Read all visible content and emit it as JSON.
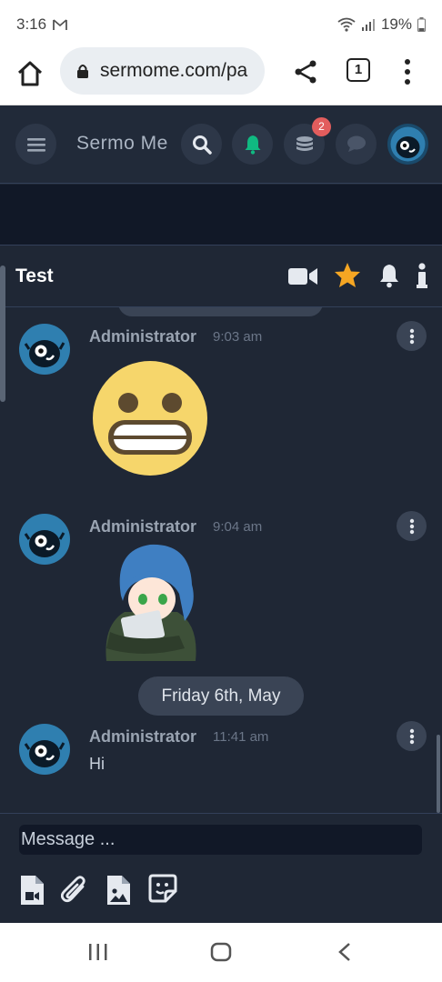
{
  "status": {
    "time": "3:16",
    "battery": "19%"
  },
  "browser": {
    "url": "sermome.com/pa",
    "tab_count": "1"
  },
  "topnav": {
    "brand": "Sermo Me",
    "notification_badge": "2"
  },
  "room": {
    "title": "Test"
  },
  "messages": [
    {
      "author": "Administrator",
      "time": "9:03 am",
      "type": "emoji"
    },
    {
      "author": "Administrator",
      "time": "9:04 am",
      "type": "sticker"
    },
    {
      "author": "Administrator",
      "time": "11:41 am",
      "text": "Hi"
    }
  ],
  "date_separator": "Friday 6th, May",
  "composer": {
    "placeholder": "Message ..."
  },
  "colors": {
    "bg": "#1f2735",
    "accent_green": "#10b981",
    "star": "#f5a623",
    "badge": "#e25d5d"
  }
}
